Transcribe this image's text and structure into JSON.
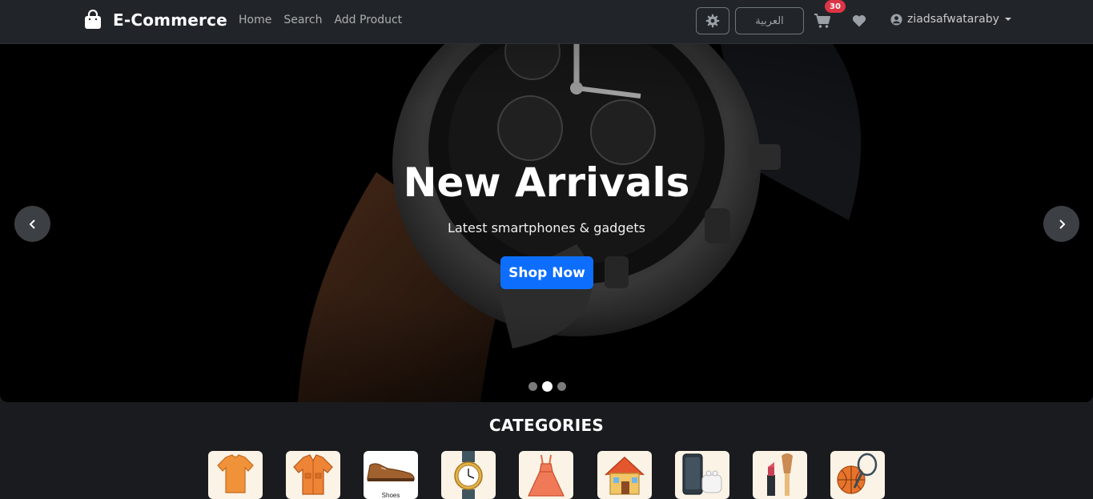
{
  "navbar": {
    "brand": "E-Commerce",
    "links": [
      "Home",
      "Search",
      "Add Product"
    ],
    "language_button": "العربية",
    "cart_count": "30",
    "username": "ziadsafwataraby"
  },
  "hero": {
    "title": "New Arrivals",
    "subtitle": "Latest smartphones & gadgets",
    "cta": "Shop Now",
    "slide_count": 3,
    "active_slide": 1
  },
  "categories": {
    "title": "CATEGORIES",
    "items": [
      {
        "icon": "tshirt-icon"
      },
      {
        "icon": "shirt-icon"
      },
      {
        "icon": "shoe-icon",
        "label": "Shoes"
      },
      {
        "icon": "watch-icon"
      },
      {
        "icon": "dress-icon"
      },
      {
        "icon": "house-icon"
      },
      {
        "icon": "phone-earbuds-icon"
      },
      {
        "icon": "cosmetics-icon"
      },
      {
        "icon": "sports-balls-icon"
      }
    ]
  },
  "colors": {
    "navbar_bg": "#212529",
    "primary": "#0d6efd",
    "badge": "#dc3545",
    "page_bg": "#1a1b1e"
  }
}
